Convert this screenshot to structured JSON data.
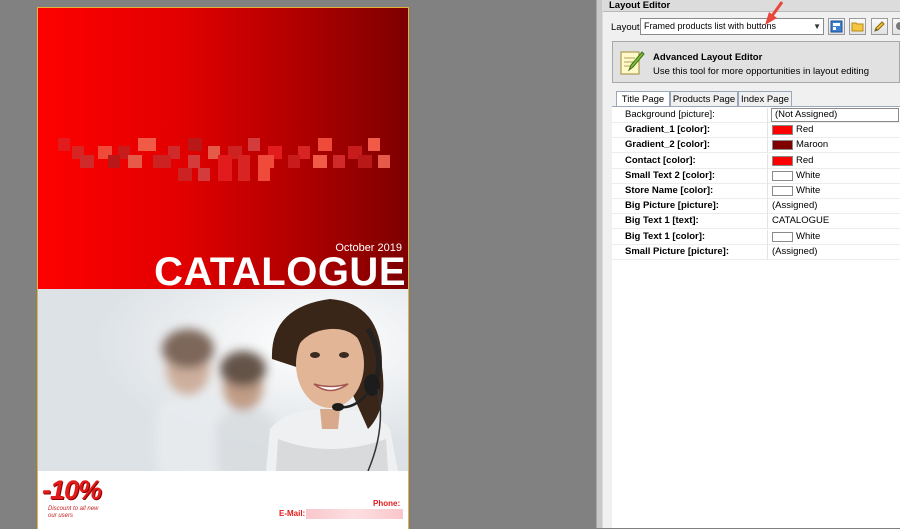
{
  "preview": {
    "date": "October 2019",
    "big_text": "CATALOGUE",
    "badge_percent": "-10%",
    "badge_subtext": "Discount to all new our users",
    "phone_label": "Phone:",
    "email_label": "E-Mail:",
    "colors": {
      "gradient_start": "#ff0000",
      "gradient_end": "#800000",
      "contact": "#e41b1b"
    }
  },
  "panel": {
    "title": "Layout Editor",
    "layout_label": "Layout",
    "layout_value": "Framed products list with buttons",
    "toolbar_icons": [
      "layout-preview-icon",
      "folder-open-icon",
      "edit-pencil-icon",
      "tools-icon"
    ],
    "advanced": {
      "title": "Advanced Layout Editor",
      "description": "Use this tool for more opportunities in layout editing"
    },
    "tabs": [
      "Title Page",
      "Products Page",
      "Index Page"
    ],
    "active_tab": 0,
    "properties": [
      {
        "name": "Background [picture]:",
        "value": "(Not Assigned)",
        "bold": false,
        "kind": "boxed"
      },
      {
        "name": "Gradient_1 [color]:",
        "value": "Red",
        "bold": true,
        "kind": "color",
        "color": "#ff0000"
      },
      {
        "name": "Gradient_2 [color]:",
        "value": "Maroon",
        "bold": true,
        "kind": "color",
        "color": "#800000"
      },
      {
        "name": "Contact [color]:",
        "value": "Red",
        "bold": true,
        "kind": "color",
        "color": "#ff0000"
      },
      {
        "name": "Small Text 2 [color]:",
        "value": "White",
        "bold": true,
        "kind": "color",
        "color": "#ffffff"
      },
      {
        "name": "Store Name [color]:",
        "value": "White",
        "bold": true,
        "kind": "color",
        "color": "#ffffff"
      },
      {
        "name": "Big Picture [picture]:",
        "value": "(Assigned)",
        "bold": true,
        "kind": "text"
      },
      {
        "name": "Big Text 1 [text]:",
        "value": "CATALOGUE",
        "bold": true,
        "kind": "text"
      },
      {
        "name": "Big Text 1 [color]:",
        "value": "White",
        "bold": true,
        "kind": "color",
        "color": "#ffffff"
      },
      {
        "name": "Small Picture [picture]:",
        "value": "(Assigned)",
        "bold": true,
        "kind": "text"
      }
    ]
  }
}
